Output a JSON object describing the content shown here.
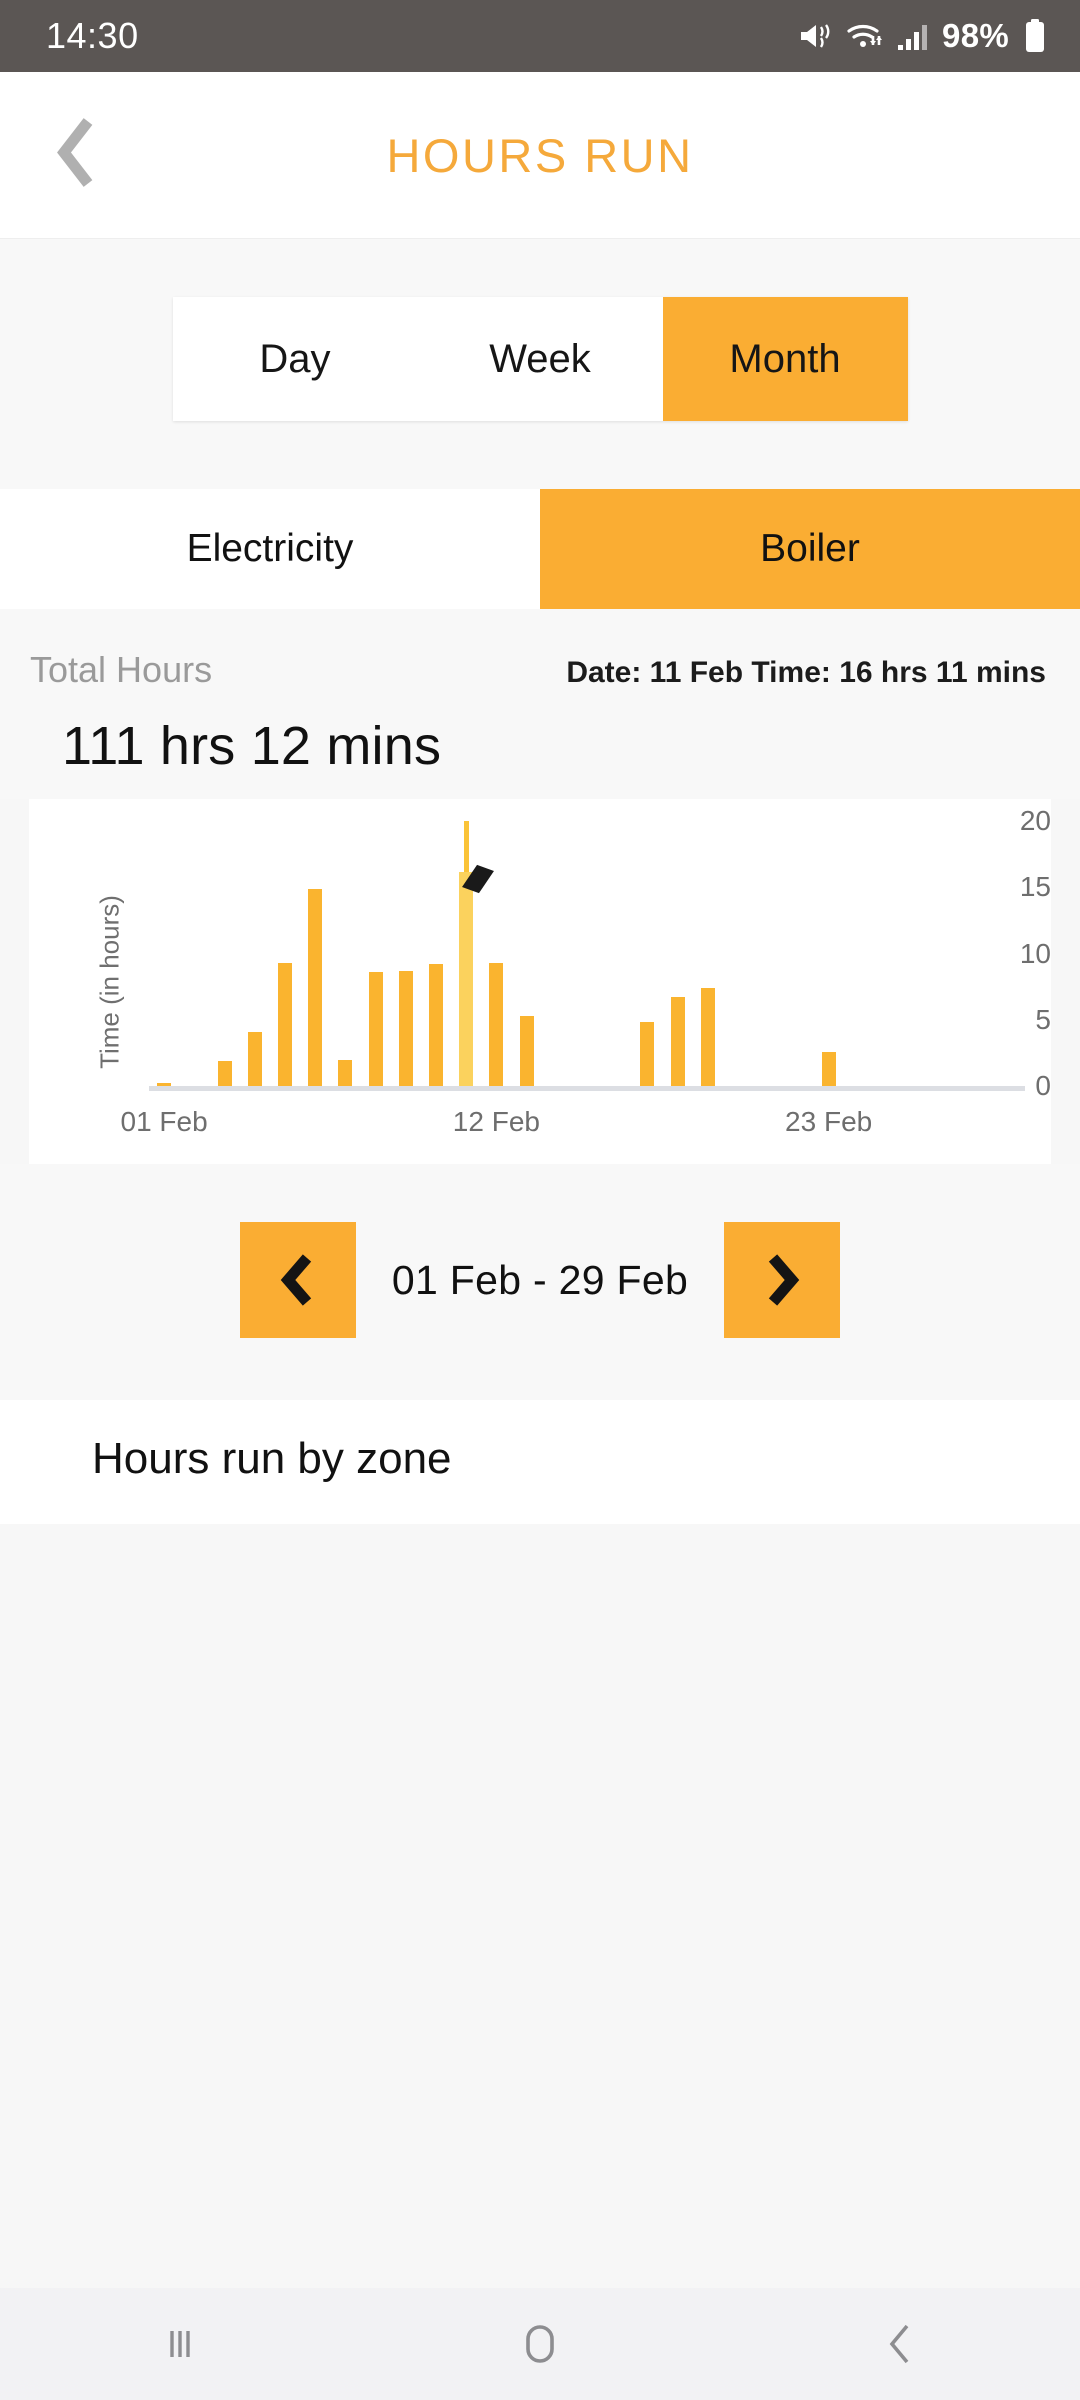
{
  "status_bar": {
    "time": "14:30",
    "battery_percent": "98%",
    "icons": [
      "mute-vibrate-icon",
      "wifi-icon",
      "signal-bars-icon",
      "battery-icon"
    ]
  },
  "app_bar": {
    "title": "HOURS RUN",
    "back_icon": "chevron-left-icon",
    "title_color": "#f5a93b"
  },
  "period_selector": {
    "options": [
      {
        "label": "Day",
        "selected": false
      },
      {
        "label": "Week",
        "selected": false
      },
      {
        "label": "Month",
        "selected": true
      }
    ]
  },
  "source_tabs": [
    {
      "label": "Electricity",
      "selected": false
    },
    {
      "label": "Boiler",
      "selected": true
    }
  ],
  "totals": {
    "label": "Total Hours",
    "tooltip": "Date: 11 Feb Time: 16 hrs 11 mins",
    "value": "111 hrs 12 mins"
  },
  "date_nav": {
    "prev_icon": "chevron-left-icon",
    "next_icon": "chevron-right-icon",
    "range": "01 Feb - 29 Feb"
  },
  "zone_section": {
    "title": "Hours run by zone"
  },
  "android_nav": {
    "recents_icon": "recents-icon",
    "home_icon": "home-icon",
    "back_icon": "back-icon"
  },
  "theme": {
    "accent": "#faad33",
    "bar": "#fab42f",
    "bar_highlight": "#fbd25d",
    "page_bg": "#f7f7f7",
    "card_bg": "#ffffff",
    "status_bg": "#5b5654",
    "axis": "#dcdee3"
  },
  "chart_data": {
    "type": "bar",
    "title": "",
    "xlabel": "",
    "ylabel": "Time (in hours)",
    "ylim": [
      0,
      20
    ],
    "yticks": [
      0,
      5,
      10,
      15,
      20
    ],
    "grid": false,
    "legend": null,
    "x_tick_labels": [
      "01 Feb",
      "12 Feb",
      "23 Feb"
    ],
    "x_tick_days": [
      1,
      12,
      23
    ],
    "highlight_day": 11,
    "highlight_value": 16.18,
    "annotation": "Date: 11 Feb Time: 16 hrs 11 mins",
    "categories": [
      "01",
      "02",
      "03",
      "04",
      "05",
      "06",
      "07",
      "08",
      "09",
      "10",
      "11",
      "12",
      "13",
      "14",
      "15",
      "16",
      "17",
      "18",
      "19",
      "20",
      "21",
      "22",
      "23",
      "24",
      "25",
      "26",
      "27",
      "28",
      "29"
    ],
    "values": [
      0.15,
      0,
      1.9,
      4.1,
      9.3,
      14.9,
      2.0,
      8.6,
      8.7,
      9.2,
      16.18,
      9.3,
      5.3,
      0,
      0,
      0,
      4.8,
      6.7,
      7.4,
      0,
      0,
      0,
      2.6,
      0,
      0,
      0,
      0,
      0,
      0
    ]
  }
}
